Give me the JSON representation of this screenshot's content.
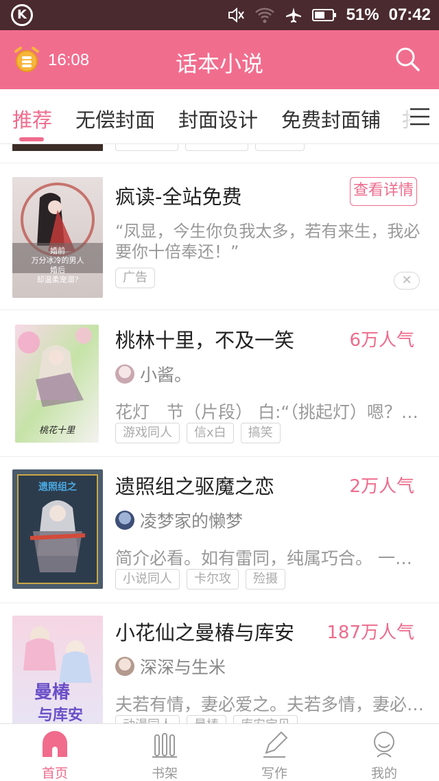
{
  "status_bar": {
    "battery": "51%",
    "time": "07:42"
  },
  "header": {
    "alarm_time": "16:08",
    "title": "话本小说"
  },
  "tabs": [
    {
      "label": "推荐",
      "active": true
    },
    {
      "label": "无偿封面"
    },
    {
      "label": "封面设计"
    },
    {
      "label": "免费封面铺"
    },
    {
      "label": "扌"
    }
  ],
  "ad": {
    "title": "疯读-全站免费",
    "button": "查看详情",
    "description": "“凤显，今生你负我太多，若有来生，我必要你十倍奉还！”",
    "tag": "广告",
    "close": "✕"
  },
  "cover_texts": {
    "ad_lines": [
      "婚前",
      "万分冰冷的男人",
      "婚后",
      "却温柔宠溺?"
    ],
    "book1": "桃花十里",
    "book2": "遗照组之",
    "book3_a": "曼椿",
    "book3_b": "与库安"
  },
  "books": [
    {
      "title": "桃林十里，不及一笑",
      "popularity": "6万人气",
      "author": "小酱。",
      "description": "花灯　节（片段）  白:“（挑起灯）嗯？…",
      "tags": [
        "游戏同人",
        "信x白",
        "搞笑"
      ]
    },
    {
      "title": "遗照组之驱魔之恋",
      "popularity": "2万人气",
      "author": "凌梦家的懒梦",
      "description": "简介必看。如有雷同，纯属巧合。 一个…",
      "tags": [
        "小说同人",
        "卡尔攻",
        "殓摄"
      ]
    },
    {
      "title": "小花仙之曼椿与库安",
      "popularity": "187万人气",
      "author": "深深与生米",
      "description": "夫若有情，妻必爱之。夫若多情，妻必…",
      "tags": [
        "动漫同人",
        "曼椿",
        "库安宝贝"
      ]
    }
  ],
  "bottom_nav": [
    {
      "label": "首页",
      "active": true
    },
    {
      "label": "书架"
    },
    {
      "label": "写作"
    },
    {
      "label": "我的"
    }
  ],
  "colors": {
    "accent": "#f06b8c",
    "status_bar": "#4a2a2e",
    "header": "#f16d8e"
  }
}
